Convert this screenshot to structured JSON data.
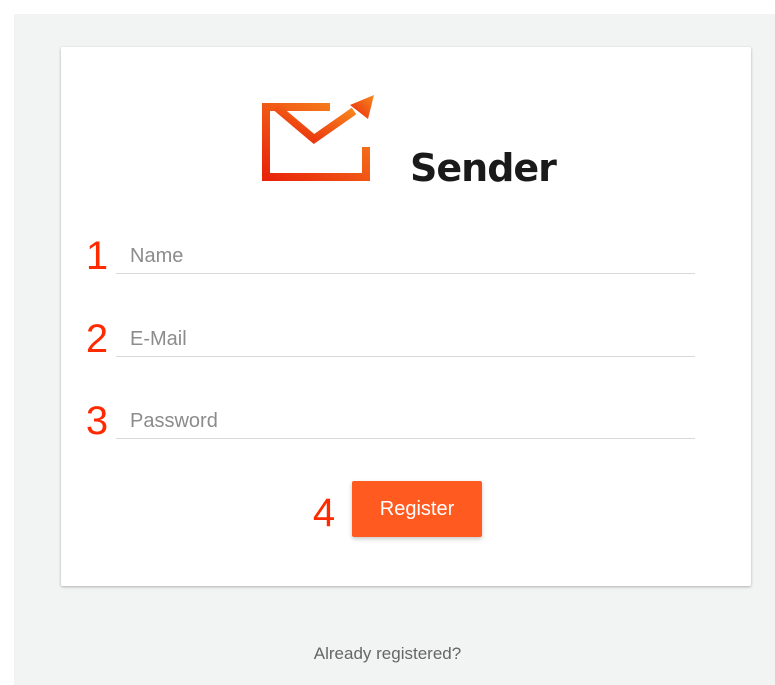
{
  "app": {
    "name": "Sender"
  },
  "form": {
    "fields": [
      {
        "number": "1",
        "placeholder": "Name",
        "value": ""
      },
      {
        "number": "2",
        "placeholder": "E-Mail",
        "value": ""
      },
      {
        "number": "3",
        "placeholder": "Password",
        "value": ""
      }
    ],
    "register": {
      "number": "4",
      "label": "Register"
    }
  },
  "footer": {
    "already_registered": "Already registered?"
  },
  "colors": {
    "accent": "#ff5b21",
    "annotation": "#ff2a00",
    "background": "#f2f3f3"
  },
  "icons": {
    "logo": "envelope-arrow-icon"
  }
}
